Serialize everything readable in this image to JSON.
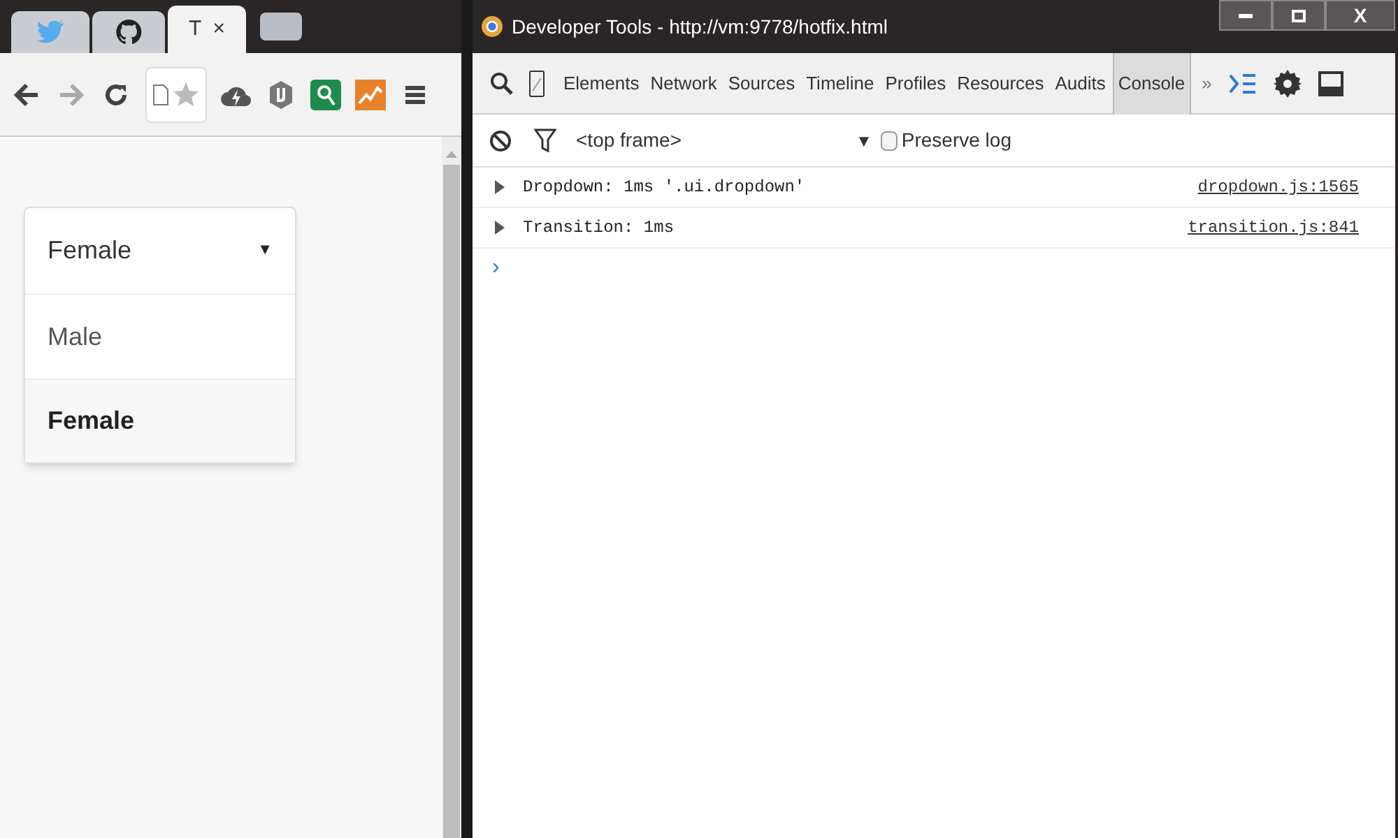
{
  "browser": {
    "tabs": [
      {
        "kind": "bird",
        "selected": false
      },
      {
        "kind": "github",
        "selected": false
      },
      {
        "kind": "page",
        "label": "T",
        "close": "×",
        "selected": true
      },
      {
        "kind": "new",
        "selected": false
      }
    ],
    "dropdown": {
      "value": "Female",
      "caret": "▼",
      "expanded": true,
      "options": [
        {
          "label": "Male",
          "selected": false
        },
        {
          "label": "Female",
          "selected": true
        }
      ]
    }
  },
  "devtools": {
    "window": {
      "title": "Developer Tools - http://vm:9778/hotfix.html",
      "close": "X"
    },
    "tabs": [
      {
        "label": "Elements",
        "selected": false
      },
      {
        "label": "Network",
        "selected": false
      },
      {
        "label": "Sources",
        "selected": false
      },
      {
        "label": "Timeline",
        "selected": false
      },
      {
        "label": "Profiles",
        "selected": false
      },
      {
        "label": "Resources",
        "selected": false
      },
      {
        "label": "Audits",
        "selected": false
      },
      {
        "label": "Console",
        "selected": true
      }
    ],
    "more": "»",
    "frame": "<top frame>",
    "frame_caret": "▼",
    "preserve_log": {
      "label": "Preserve log",
      "checked": false
    },
    "messages": [
      {
        "text": "Dropdown: 1ms '.ui.dropdown'",
        "source": "dropdown.js:1565"
      },
      {
        "text": "Transition: 1ms",
        "source": "transition.js:841"
      }
    ],
    "prompt": "›"
  }
}
